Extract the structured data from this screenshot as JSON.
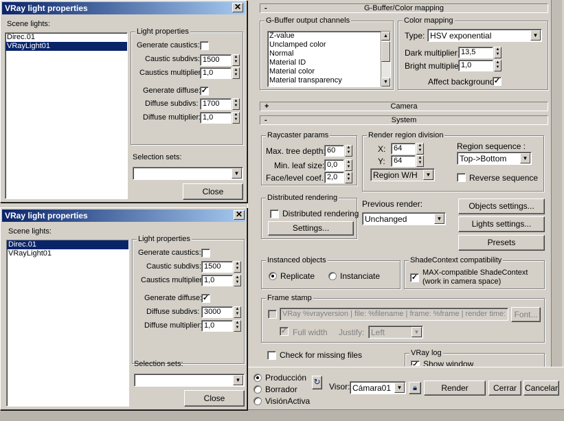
{
  "win1": {
    "title": "VRay light properties",
    "close_x": "✕",
    "scene_lights_label": "Scene lights:",
    "lights": [
      "Direc.01",
      "VRayLight01"
    ],
    "light_props_group": "Light properties",
    "generate_caustics": "Generate caustics:",
    "caustic_subdivs": "Caustic subdivs:",
    "caustic_subdivs_val": "1500",
    "caustics_multiplier": "Caustics multiplier:",
    "caustics_multiplier_val": "1,0",
    "generate_diffuse": "Generate diffuse:",
    "diffuse_subdivs": "Diffuse subdivs:",
    "diffuse_subdivs_val": "1700",
    "diffuse_multiplier": "Diffuse multiplier:",
    "diffuse_multiplier_val": "1,0",
    "selection_sets": "Selection sets:",
    "close_btn": "Close"
  },
  "win2": {
    "title": "VRay light properties",
    "close_x": "✕",
    "scene_lights_label": "Scene lights:",
    "lights": [
      "Direc.01",
      "VRayLight01"
    ],
    "light_props_group": "Light properties",
    "generate_caustics": "Generate caustics:",
    "caustic_subdivs": "Caustic subdivs:",
    "caustic_subdivs_val": "1500",
    "caustics_multiplier": "Caustics multiplier:",
    "caustics_multiplier_val": "1,0",
    "generate_diffuse": "Generate diffuse:",
    "diffuse_subdivs": "Diffuse subdivs:",
    "diffuse_subdivs_val": "3000",
    "diffuse_multiplier": "Diffuse multiplier:",
    "diffuse_multiplier_val": "1,0",
    "selection_sets": "Selection sets:",
    "close_btn": "Close"
  },
  "render": {
    "gbuffer_rollout": "G-Buffer/Color mapping",
    "gbuffer_group": "G-Buffer output channels",
    "gbuffer_channels": [
      "Z-value",
      "Unclamped color",
      "Normal",
      "Material ID",
      "Material color",
      "Material transparency"
    ],
    "color_mapping_group": "Color mapping",
    "type_label": "Type:",
    "type_value": "HSV exponential",
    "dark_mult": "Dark multiplier:",
    "dark_mult_val": "13,5",
    "bright_mult": "Bright multiplier:",
    "bright_mult_val": "1,0",
    "affect_bg": "Affect background",
    "camera_rollout": "Camera",
    "system_rollout": "System",
    "raycaster_group": "Raycaster params",
    "max_tree_depth": "Max. tree depth:",
    "max_tree_depth_val": "60",
    "min_leaf_size": "Min. leaf size:",
    "min_leaf_size_val": "0,0",
    "face_level": "Face/level coef.",
    "face_level_val": "2,0",
    "region_group": "Render region division",
    "x_label": "X:",
    "x_val": "64",
    "y_label": "Y:",
    "y_val": "64",
    "region_wh": "Region W/H",
    "region_seq_label": "Region sequence :",
    "region_seq_val": "Top->Bottom",
    "reverse_seq": "Reverse sequence",
    "distributed_group": "Distributed rendering",
    "distributed_cb": "Distributed rendering",
    "settings_btn": "Settings...",
    "previous_render": "Previous render:",
    "previous_render_val": "Unchanged",
    "objects_settings": "Objects settings...",
    "lights_settings": "Lights settings...",
    "presets": "Presets",
    "instanced_group": "Instanced objects",
    "replicate": "Replicate",
    "instanciate": "Instanciate",
    "shadecontext_group": "ShadeContext compatibility",
    "max_compatible": "MAX-compatible ShadeContext",
    "max_compatible2": "(work in camera space)",
    "frame_stamp_group": "Frame stamp",
    "frame_stamp_text": "VRay %vrayversion | file: %filename | frame: %frame | render time: %rer",
    "font_btn": "Font...",
    "full_width": "Full width",
    "justify": "Justify:",
    "justify_val": "Left",
    "check_missing": "Check for missing files",
    "vray_log_group": "VRay log",
    "show_window": "Show window"
  },
  "bottom": {
    "produccion": "Producción",
    "borrador": "Borrador",
    "vision_activa": "VisiónActiva",
    "visor_label": "Visor:",
    "visor_val": "Cámara01",
    "render_btn": "Render",
    "cerrar_btn": "Cerrar",
    "cancelar_btn": "Cancelar"
  }
}
